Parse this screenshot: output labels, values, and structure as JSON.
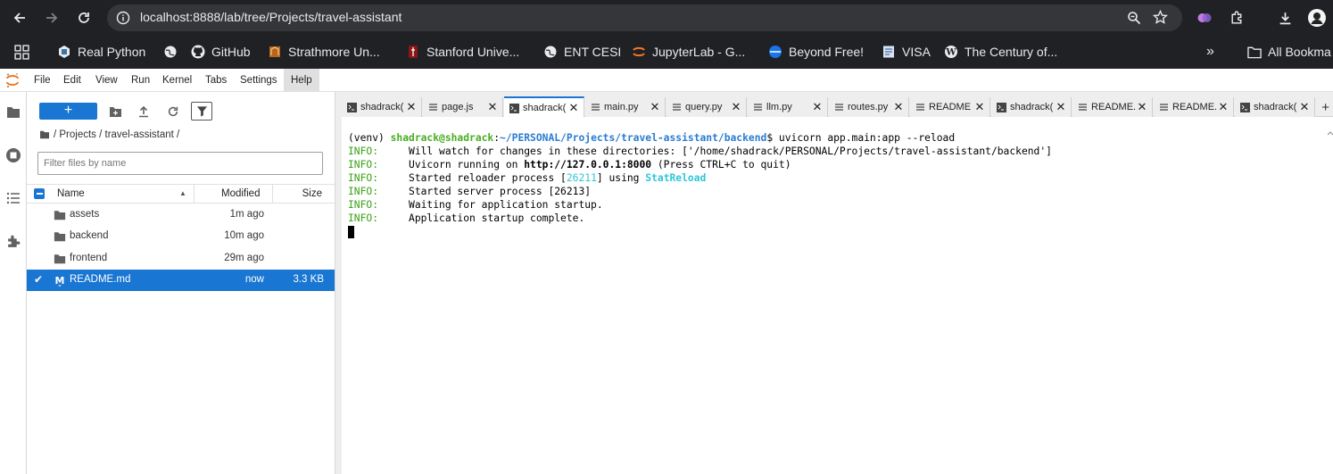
{
  "browser": {
    "url": "localhost:8888/lab/tree/Projects/travel-assistant",
    "bookmarks": [
      {
        "label": "Real Python"
      },
      {
        "label": "GitHub"
      },
      {
        "label": "Strathmore Un..."
      },
      {
        "label": "Stanford Unive..."
      },
      {
        "label": "ENT CESI"
      },
      {
        "label": "JupyterLab - G..."
      },
      {
        "label": "Beyond Free!"
      },
      {
        "label": "VISA"
      },
      {
        "label": "The Century of..."
      }
    ],
    "overflow": "»",
    "all_bookmarks": "All Bookma"
  },
  "menubar": {
    "items": [
      "File",
      "Edit",
      "View",
      "Run",
      "Kernel",
      "Tabs",
      "Settings",
      "Help"
    ]
  },
  "filebrowser": {
    "new_label": "+",
    "breadcrumb": "/ Projects / travel-assistant /",
    "filter_placeholder": "Filter files by name",
    "columns": {
      "name": "Name",
      "modified": "Modified",
      "size": "Size"
    },
    "rows": [
      {
        "name": "assets",
        "modified": "1m ago",
        "size": "",
        "type": "folder"
      },
      {
        "name": "backend",
        "modified": "10m ago",
        "size": "",
        "type": "folder"
      },
      {
        "name": "frontend",
        "modified": "29m ago",
        "size": "",
        "type": "folder"
      },
      {
        "name": "README.md",
        "modified": "now",
        "size": "3.3 KB",
        "type": "markdown"
      }
    ]
  },
  "tabs": [
    {
      "label": "shadrack(",
      "icon": "terminal-icon"
    },
    {
      "label": "page.js",
      "icon": "file-icon"
    },
    {
      "label": "shadrack(",
      "icon": "terminal-icon",
      "active": true
    },
    {
      "label": "main.py",
      "icon": "file-icon"
    },
    {
      "label": "query.py",
      "icon": "file-icon"
    },
    {
      "label": "llm.py",
      "icon": "file-icon"
    },
    {
      "label": "routes.py",
      "icon": "file-icon"
    },
    {
      "label": "README",
      "icon": "markdown-icon"
    },
    {
      "label": "shadrack(",
      "icon": "terminal-icon"
    },
    {
      "label": "README.",
      "icon": "markdown-icon"
    },
    {
      "label": "README.",
      "icon": "markdown-icon"
    },
    {
      "label": "shadrack(",
      "icon": "terminal-icon"
    }
  ],
  "terminal": {
    "prompt_venv": "(venv) ",
    "prompt_user": "shadrack@shadrack",
    "prompt_colon": ":",
    "prompt_path": "~/PERSONAL/Projects/travel-assistant/backend",
    "prompt_cmd": "$ uvicorn app.main:app --reload",
    "info": "INFO:",
    "line1": "     Will watch for changes in these directories: ['/home/shadrack/PERSONAL/Projects/travel-assistant/backend']",
    "line2_a": "     Uvicorn running on ",
    "line2_url": "http://127.0.0.1:8000",
    "line2_b": " (Press CTRL+C to quit)",
    "line3_a": "     Started reloader process [",
    "line3_pid": "26211",
    "line3_b": "] using ",
    "line3_reload": "StatReload",
    "line4": "     Started server process [26213]",
    "line5": "     Waiting for application startup.",
    "line6": "     Application startup complete."
  }
}
